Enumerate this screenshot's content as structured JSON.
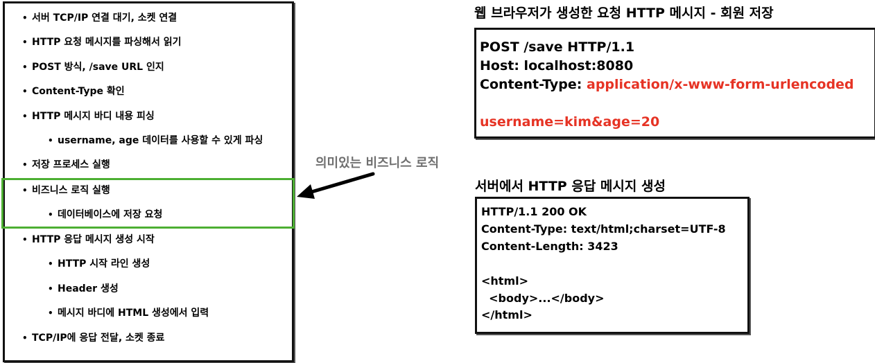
{
  "steps": [
    "서버 TCP/IP 연결 대기, 소켓 연결",
    "HTTP 요청 메시지를 파싱해서 읽기",
    "POST 방식, /save URL 인지",
    "Content-Type 확인",
    "HTTP 메시지 바디 내용 피싱",
    "username, age 데이터를 사용할 수 있게 파싱",
    "저장 프로세스 실행",
    "비즈니스 로직 실행",
    "데이터베이스에 저장 요청",
    "HTTP 응답 메시지 생성 시작",
    "HTTP 시작 라인 생성",
    "Header 생성",
    "메시지 바디에 HTML 생성에서 입력",
    "TCP/IP에 응답 전달, 소켓 종료"
  ],
  "bullet": "•",
  "annotation": "의미있는 비즈니스 로직",
  "request": {
    "title": "웹 브라우저가 생성한 요청 HTTP 메시지 - 회원 저장",
    "line1": "POST /save HTTP/1.1",
    "line2": "Host: localhost:8080",
    "line3_label": "Content-Type: ",
    "line3_value": "application/x-www-form-urlencoded",
    "body": "username=kim&age=20"
  },
  "response": {
    "title": "서버에서 HTTP 응답 메시지 생성",
    "line1": "HTTP/1.1 200 OK",
    "line2": "Content-Type: text/html;charset=UTF-8",
    "line3": "Content-Length: 3423",
    "line4": "<html>",
    "line5": "  <body>...</body>",
    "line6": "</html>"
  },
  "colors": {
    "highlight": "#4caf32",
    "accent_red": "#e63324",
    "annotation": "#6f6f6f"
  }
}
